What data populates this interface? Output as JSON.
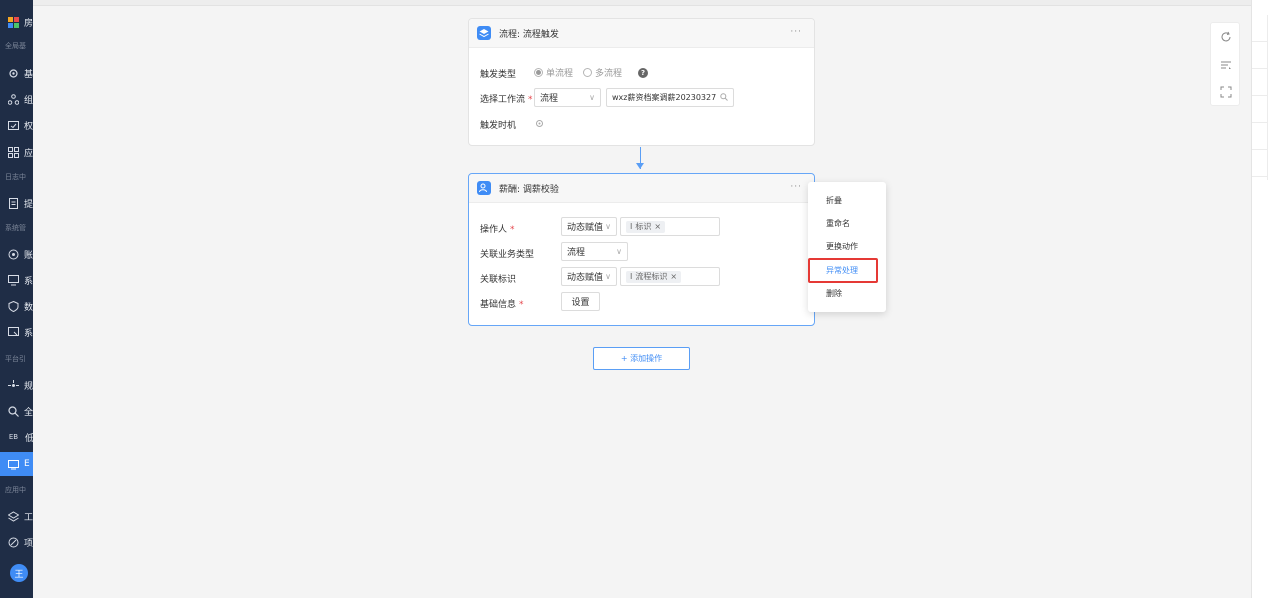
{
  "sidebar": {
    "groups": [
      {
        "label": "全局基"
      },
      {
        "label": "日志中"
      },
      {
        "label": "系统管"
      },
      {
        "label": "平台引"
      },
      {
        "label": "应用中"
      }
    ],
    "items": [
      {
        "label": "房",
        "icon": "grid-icon"
      },
      {
        "label": "基",
        "icon": "gear-icon"
      },
      {
        "label": "组",
        "icon": "org-icon"
      },
      {
        "label": "权",
        "icon": "permission-icon"
      },
      {
        "label": "应",
        "icon": "apps-icon"
      },
      {
        "label": "提",
        "icon": "doc-icon"
      },
      {
        "label": "账",
        "icon": "shield-icon"
      },
      {
        "label": "系",
        "icon": "monitor-icon"
      },
      {
        "label": "数",
        "icon": "data-shield-icon"
      },
      {
        "label": "系",
        "icon": "screen-icon"
      },
      {
        "label": "规",
        "icon": "rule-icon"
      },
      {
        "label": "全",
        "icon": "search-icon"
      },
      {
        "label": "低",
        "icon": "eb-icon",
        "prefix": "EB"
      },
      {
        "label": "E",
        "icon": "eb-screen-icon",
        "active": true
      },
      {
        "label": "工",
        "icon": "layers-icon"
      },
      {
        "label": "项",
        "icon": "project-icon"
      }
    ],
    "avatar": "王"
  },
  "trigger_card": {
    "title": "流程: 流程触发",
    "more": "···",
    "trigger_type_label": "触发类型",
    "radio_single": "单流程",
    "radio_multi": "多流程",
    "help": "?",
    "workflow_label": "选择工作流",
    "workflow_select": "流程",
    "workflow_search_value": "wxz薪资档案调薪20230327",
    "timing_label": "触发时机"
  },
  "salary_card": {
    "title": "薪酬: 调薪校验",
    "more": "···",
    "operator_label": "操作人",
    "operator_mode": "动态赋值",
    "operator_tag": "标识",
    "biz_type_label": "关联业务类型",
    "biz_type_value": "流程",
    "relation_label": "关联标识",
    "relation_mode": "动态赋值",
    "relation_tag": "流程标识",
    "basic_info_label": "基础信息",
    "basic_info_button": "设置"
  },
  "add_action": "+ 添加操作",
  "context_menu": {
    "items": [
      "折叠",
      "重命名",
      "更换动作",
      "异常处理",
      "删除"
    ],
    "highlighted": "异常处理"
  },
  "colors": {
    "accent": "#3f8cf5",
    "sidebar_bg": "#1f2d46",
    "required": "#e5484d",
    "highlight_box": "#e53935"
  }
}
